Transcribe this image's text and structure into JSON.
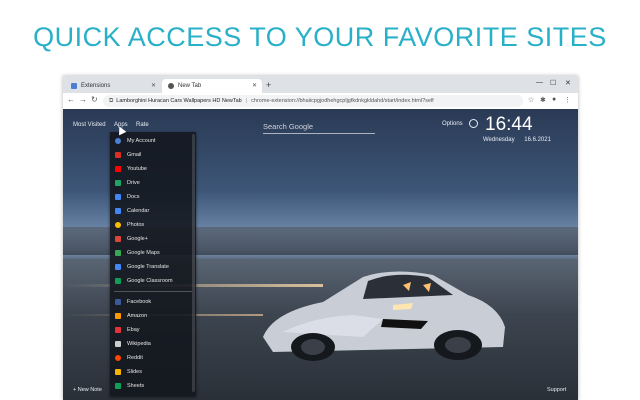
{
  "headline": "QUICK ACCESS TO YOUR FAVORITE SITES",
  "tabs": [
    {
      "label": "Extensions",
      "active": false,
      "icon": "puzzle-icon"
    },
    {
      "label": "New Tab",
      "active": true,
      "icon": "newtab-icon"
    }
  ],
  "toolbar": {
    "site_name": "Lamborghini Huracan Cars Wallpapers HD NewTab",
    "url": "chrome-extension://bhaiicpgjodhehgcpljgfkdnkgkldahd/start/index.html?self"
  },
  "page": {
    "links": [
      "Most Visited",
      "Apps",
      "Rate"
    ],
    "search_placeholder": "Search Google",
    "options_label": "Options",
    "time": "16:44",
    "day": "Wednesday",
    "date": "16.6.2021",
    "new_note": "+ New Note",
    "support": "Support"
  },
  "apps_menu": {
    "google": [
      {
        "label": "My Account",
        "color": "#4a7fd4"
      },
      {
        "label": "Gmail",
        "color": "#d93025"
      },
      {
        "label": "Youtube",
        "color": "#ff0000"
      },
      {
        "label": "Drive",
        "color": "#1fa463"
      },
      {
        "label": "Docs",
        "color": "#4285f4"
      },
      {
        "label": "Calendar",
        "color": "#4285f4"
      },
      {
        "label": "Photos",
        "color": "#fbbc04"
      },
      {
        "label": "Google+",
        "color": "#db4437"
      },
      {
        "label": "Google Maps",
        "color": "#34a853"
      },
      {
        "label": "Google Translate",
        "color": "#4285f4"
      },
      {
        "label": "Google Classroom",
        "color": "#0f9d58"
      }
    ],
    "other": [
      {
        "label": "Facebook",
        "color": "#3b5998"
      },
      {
        "label": "Amazon",
        "color": "#ff9900"
      },
      {
        "label": "Ebay",
        "color": "#e53238"
      },
      {
        "label": "Wikipedia",
        "color": "#cccccc"
      },
      {
        "label": "Reddit",
        "color": "#ff4500"
      },
      {
        "label": "Slides",
        "color": "#f4b400"
      },
      {
        "label": "Sheets",
        "color": "#0f9d58"
      }
    ]
  }
}
